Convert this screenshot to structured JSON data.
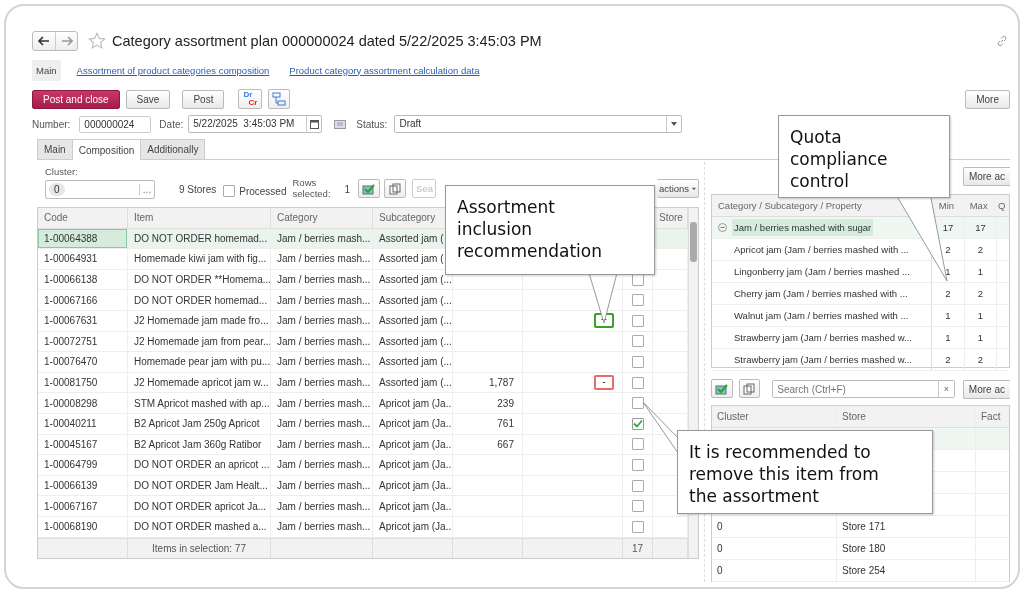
{
  "title": "Category assortment plan 000000024 dated 5/22/2025 3:45:03 PM",
  "favorite": false,
  "sections": [
    {
      "label": "Main",
      "selected": true
    },
    {
      "label": "Assortment of product categories composition",
      "selected": false
    },
    {
      "label": "Product category assortment calculation data",
      "selected": false
    }
  ],
  "toolbar": {
    "buttons": [
      {
        "label": "Post and close",
        "kind": "primary"
      },
      {
        "label": "Save",
        "kind": "default"
      },
      {
        "label": "Post",
        "kind": "default"
      }
    ],
    "dr_cr": [
      "Dr",
      "Cr"
    ],
    "more": "More"
  },
  "fields": {
    "number_label": "Number:",
    "number": "000000024",
    "date_label": "Date:",
    "date": "5/22/2025  3:45:03 PM",
    "status_label": "Status:",
    "status": "Draft"
  },
  "tabs": [
    {
      "label": "Main",
      "selected": false
    },
    {
      "label": "Composition",
      "selected": true
    },
    {
      "label": "Additionally",
      "selected": false
    }
  ],
  "cluster": {
    "label": "Cluster:",
    "value": "0",
    "picker": "..."
  },
  "stores": "9 Stores",
  "processed": {
    "label": "Processed",
    "checked": false
  },
  "rows_selected_label": "Rows selected:",
  "rows_selected": "1",
  "search_placeholder": "Sea",
  "actions": "actions",
  "items_table": {
    "columns": [
      "Code",
      "Item",
      "Category",
      "Subcategory",
      "Store"
    ],
    "rows": [
      {
        "code": "1-00064388",
        "item": "DO NOT ORDER homemad...",
        "category": "Jam / berries mash...",
        "subcategory": "Assorted jam (",
        "selected": true
      },
      {
        "code": "1-00064931",
        "item": "Homemade kiwi jam with fig...",
        "category": "Jam / berries mash...",
        "subcategory": "Assorted jam (",
        "selected": false
      },
      {
        "code": "1-00066138",
        "item": "DO NOT ORDER **Homema...",
        "category": "Jam / berries mash...",
        "subcategory": "Assorted jam (...",
        "checked": false,
        "selected": false
      },
      {
        "code": "1-00067166",
        "item": "DO NOT ORDER homemad...",
        "category": "Jam / berries mash...",
        "subcategory": "Assorted jam (...",
        "checked": false,
        "selected": false
      },
      {
        "code": "1-00067631",
        "item": "J2 Homemade jam made fro...",
        "category": "Jam / berries mash...",
        "subcategory": "Assorted jam (...",
        "recommendation": {
          "kind": "include",
          "symbol": "+"
        },
        "checked": false,
        "selected": false
      },
      {
        "code": "1-00072751",
        "item": "J2 Homemade jam from pear...",
        "category": "Jam / berries mash...",
        "subcategory": "Assorted jam (...",
        "checked": false,
        "selected": false
      },
      {
        "code": "1-00076470",
        "item": "Homemade pear jam with pu...",
        "category": "Jam / berries mash...",
        "subcategory": "Assorted jam (...",
        "checked": false,
        "selected": false
      },
      {
        "code": "1-00081750",
        "item": "J2 Homemade apricot jam w...",
        "category": "Jam / berries mash...",
        "subcategory": "Assorted jam (...",
        "column_5": "1,787",
        "recommendation": {
          "kind": "exclude",
          "symbol": "-"
        },
        "checked": false,
        "selected": false
      },
      {
        "code": "1-00008298",
        "item": "STM Apricot mashed with ap...",
        "category": "Jam / berries mash...",
        "subcategory": "Apricot jam (Ja...",
        "column_5": "239",
        "checked": false,
        "selected": false
      },
      {
        "code": "1-00040211",
        "item": "B2 Apricot Jam 250g Apricot",
        "category": "Jam / berries mash...",
        "subcategory": "Apricot jam (Ja...",
        "column_5": "761",
        "checked": true,
        "selected": false
      },
      {
        "code": "1-00045167",
        "item": "B2 Apricot Jam 360g Ratibor",
        "category": "Jam / berries mash...",
        "subcategory": "Apricot jam (Ja...",
        "column_5": "667",
        "checked": false,
        "selected": false
      },
      {
        "code": "1-00064799",
        "item": "DO NOT ORDER an apricot ...",
        "category": "Jam / berries mash...",
        "subcategory": "Apricot jam (Ja...",
        "checked": false,
        "selected": false
      },
      {
        "code": "1-00066139",
        "item": "DO NOT ORDER Jam Healt...",
        "category": "Jam / berries mash...",
        "subcategory": "Apricot jam (Ja...",
        "checked": false,
        "selected": false
      },
      {
        "code": "1-00067167",
        "item": "DO NOT ORDER apricot Ja...",
        "category": "Jam / berries mash...",
        "subcategory": "Apricot jam (Ja...",
        "checked": false,
        "selected": false
      },
      {
        "code": "1-00068190",
        "item": "DO NOT ORDER mashed a...",
        "category": "Jam / berries mash...",
        "subcategory": "Apricot jam (Ja...",
        "checked": false,
        "selected": false
      }
    ],
    "footer": {
      "summary": "Items in selection: 77",
      "total": "17"
    }
  },
  "quota_panel": {
    "more": "More ac",
    "columns": [
      "Category / Subcategory / Property",
      "Min",
      "Max",
      "Q"
    ],
    "groups": [
      {
        "label": "Jam / berries mashed with sugar",
        "min": "17",
        "max": "17",
        "expanded": true,
        "selected": true,
        "children": [
          {
            "label": "Apricot jam (Jam / berries mashed with ...",
            "min": "2",
            "max": "2"
          },
          {
            "label": "Lingonberry jam (Jam / berries mashed ...",
            "min": "1",
            "max": "1"
          },
          {
            "label": "Cherry jam (Jam / berries mashed with ...",
            "min": "2",
            "max": "2"
          },
          {
            "label": "Walnut jam (Jam / berries mashed with ...",
            "min": "1",
            "max": "1"
          },
          {
            "label": "Strawberry jam (Jam / berries mashed w...",
            "min": "1",
            "max": "1"
          },
          {
            "label": "Strawberry jam (Jam / berries mashed w...",
            "min": "2",
            "max": "2"
          }
        ]
      }
    ]
  },
  "stores_panel": {
    "search_placeholder": "Search (Ctrl+F)",
    "clear": "×",
    "more": "More ac",
    "columns": [
      "Cluster",
      "Store",
      "Fact"
    ],
    "rows": [
      {
        "selected": true
      },
      {
        "selected": false
      },
      {
        "selected": false
      },
      {
        "selected": false
      },
      {
        "cluster": "0",
        "store": "Store 171",
        "selected": false
      },
      {
        "cluster": "0",
        "store": "Store 180",
        "selected": false
      },
      {
        "cluster": "0",
        "store": "Store 254",
        "selected": false
      }
    ]
  },
  "callouts": [
    {
      "text": "Assortment inclusion recommendation"
    },
    {
      "text": "Quota compliance control"
    },
    {
      "text": "It is recommended to remove this item from the assortment"
    }
  ]
}
